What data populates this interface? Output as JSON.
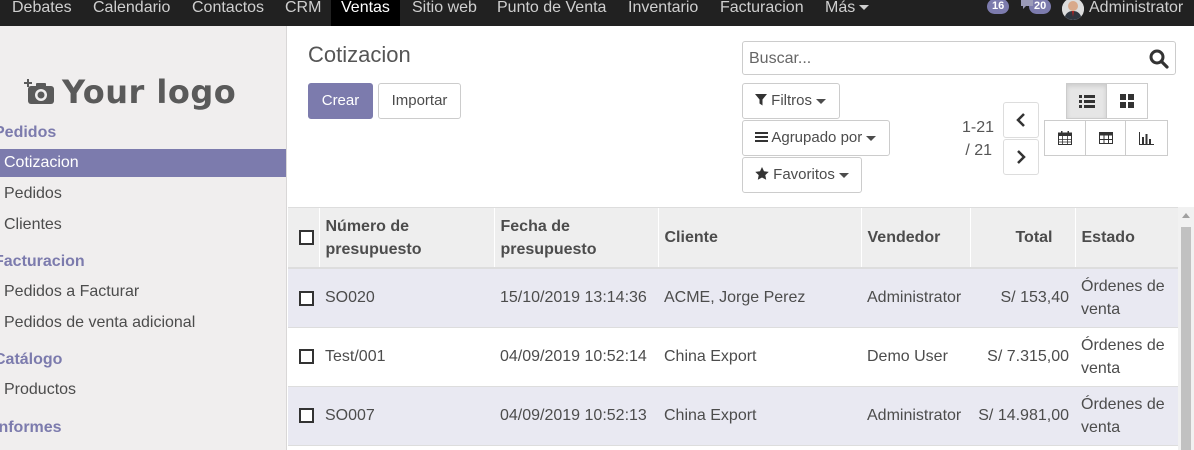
{
  "topnav": {
    "items": [
      "Debates",
      "Calendario",
      "Contactos",
      "CRM",
      "Ventas",
      "Sitio web",
      "Punto de Venta",
      "Inventario",
      "Facturacion",
      "Más"
    ],
    "active": "Ventas",
    "badge_messages": "16",
    "badge_chat": "20",
    "user": "Administrator"
  },
  "sidebar": {
    "logo_text": "Your logo",
    "sections": [
      {
        "title": "Pedidos",
        "items": [
          "Cotizacion",
          "Pedidos",
          "Clientes"
        ]
      },
      {
        "title": "Facturacion",
        "items": [
          "Pedidos a Facturar",
          "Pedidos de venta adicional"
        ]
      },
      {
        "title": "Catálogo",
        "items": [
          "Productos"
        ]
      },
      {
        "title": "Informes",
        "items": []
      }
    ],
    "active_item": "Cotizacion"
  },
  "control_panel": {
    "title": "Cotizacion",
    "create_label": "Crear",
    "import_label": "Importar",
    "search_placeholder": "Buscar...",
    "filters_label": "Filtros",
    "groupby_label": "Agrupado por",
    "favorites_label": "Favoritos",
    "pager_range": "1-21",
    "pager_total": "/ 21"
  },
  "table": {
    "headers": [
      "Número de presupuesto",
      "Fecha de presupuesto",
      "Cliente",
      "Vendedor",
      "Total",
      "Estado"
    ],
    "rows": [
      [
        "SO020",
        "15/10/2019 13:14:36",
        "ACME, Jorge Perez",
        "Administrator",
        "S/ 153,40",
        "Órdenes de venta"
      ],
      [
        "Test/001",
        "04/09/2019 10:52:14",
        "China Export",
        "Demo User",
        "S/ 7.315,00",
        "Órdenes de venta"
      ],
      [
        "SO007",
        "04/09/2019 10:52:13",
        "China Export",
        "Administrator",
        "S/ 14.981,00",
        "Órdenes de venta"
      ]
    ]
  },
  "colors": {
    "brand": "#7c7bad",
    "topbar": "#212121"
  }
}
